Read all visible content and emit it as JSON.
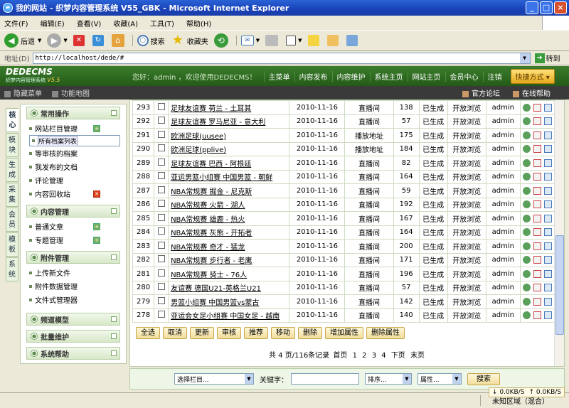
{
  "window": {
    "title": "我的网站 - 织梦内容管理系统 V55_GBK - Microsoft Internet Explorer"
  },
  "menu": [
    "文件(F)",
    "编辑(E)",
    "查看(V)",
    "收藏(A)",
    "工具(T)",
    "帮助(H)"
  ],
  "toolbar": {
    "back": "后退",
    "search": "搜索",
    "favorites": "收藏夹"
  },
  "address": {
    "label": "地址(D)",
    "url": "http://localhost/dede/#",
    "go": "转到"
  },
  "dede": {
    "logo": "DEDECMS",
    "logo_sub": "织梦内容管理系统",
    "version": "V5.5",
    "welcome": "您好：admin ，欢迎使用DEDECMS！",
    "nav": [
      "主菜单",
      "内容发布",
      "内容维护",
      "系统主页",
      "网站主页",
      "会员中心",
      "注销"
    ],
    "shortcut": "快捷方式"
  },
  "subbar": {
    "hide": "隐藏菜单",
    "map": "功能地图",
    "forum": "官方论坛",
    "help": "在线帮助"
  },
  "vtabs": [
    "核心",
    "模块",
    "生成",
    "采集",
    "会员",
    "模板",
    "系统"
  ],
  "sidebar": {
    "g1": "常用操作",
    "g1_items": [
      "网站栏目管理",
      "所有档案列表",
      "等审核的档案",
      "我发布的文档",
      "评论管理",
      "内容回收站"
    ],
    "g2": "内容管理",
    "g2_items": [
      "普通文章",
      "专题管理"
    ],
    "g3": "附件管理",
    "g3_items": [
      "上传新文件",
      "附件数据管理",
      "文件式管理器"
    ],
    "g4": "频道模型",
    "g5": "批量维护",
    "g6": "系统帮助"
  },
  "rows": [
    {
      "id": "293",
      "title": "足球友谊赛 荷兰 - 土耳其",
      "date": "2010-11-16",
      "type": "直播间",
      "clicks": "138",
      "status": "已生成",
      "perm": "开放浏览",
      "user": "admin"
    },
    {
      "id": "292",
      "title": "足球友谊赛 罗马尼亚 - 意大利",
      "date": "2010-11-16",
      "type": "直播间",
      "clicks": "57",
      "status": "已生成",
      "perm": "开放浏览",
      "user": "admin"
    },
    {
      "id": "291",
      "title": "欧洲足球(uusee)",
      "date": "2010-11-16",
      "type": "播放地址",
      "clicks": "175",
      "status": "已生成",
      "perm": "开放浏览",
      "user": "admin"
    },
    {
      "id": "290",
      "title": "欧洲足球(pplive)",
      "date": "2010-11-16",
      "type": "播放地址",
      "clicks": "184",
      "status": "已生成",
      "perm": "开放浏览",
      "user": "admin"
    },
    {
      "id": "289",
      "title": "足球友谊赛 巴西 - 阿根廷",
      "date": "2010-11-16",
      "type": "直播间",
      "clicks": "82",
      "status": "已生成",
      "perm": "开放浏览",
      "user": "admin"
    },
    {
      "id": "288",
      "title": "亚运男篮小组赛 中国男篮 - 朝鲜",
      "date": "2010-11-16",
      "type": "直播间",
      "clicks": "164",
      "status": "已生成",
      "perm": "开放浏览",
      "user": "admin"
    },
    {
      "id": "287",
      "title": "NBA常规赛 掘金 - 尼克斯",
      "date": "2010-11-16",
      "type": "直播间",
      "clicks": "59",
      "status": "已生成",
      "perm": "开放浏览",
      "user": "admin"
    },
    {
      "id": "286",
      "title": "NBA常规赛 火箭 - 湖人",
      "date": "2010-11-16",
      "type": "直播间",
      "clicks": "192",
      "status": "已生成",
      "perm": "开放浏览",
      "user": "admin"
    },
    {
      "id": "285",
      "title": "NBA常规赛 雄鹿 - 热火",
      "date": "2010-11-16",
      "type": "直播间",
      "clicks": "167",
      "status": "已生成",
      "perm": "开放浏览",
      "user": "admin"
    },
    {
      "id": "284",
      "title": "NBA常规赛 灰熊 - 开拓者",
      "date": "2010-11-16",
      "type": "直播间",
      "clicks": "164",
      "status": "已生成",
      "perm": "开放浏览",
      "user": "admin"
    },
    {
      "id": "283",
      "title": "NBA常规赛 奇才 - 猛龙",
      "date": "2010-11-16",
      "type": "直播间",
      "clicks": "200",
      "status": "已生成",
      "perm": "开放浏览",
      "user": "admin"
    },
    {
      "id": "282",
      "title": "NBA常规赛 步行者 - 老鹰",
      "date": "2010-11-16",
      "type": "直播间",
      "clicks": "171",
      "status": "已生成",
      "perm": "开放浏览",
      "user": "admin"
    },
    {
      "id": "281",
      "title": "NBA常规赛 骑士 - 76人",
      "date": "2010-11-16",
      "type": "直播间",
      "clicks": "196",
      "status": "已生成",
      "perm": "开放浏览",
      "user": "admin"
    },
    {
      "id": "280",
      "title": "友谊赛 德国U21-英格兰U21",
      "date": "2010-11-16",
      "type": "直播间",
      "clicks": "57",
      "status": "已生成",
      "perm": "开放浏览",
      "user": "admin"
    },
    {
      "id": "279",
      "title": "男篮小组赛 中国男篮vs蒙古",
      "date": "2010-11-16",
      "type": "直播间",
      "clicks": "142",
      "status": "已生成",
      "perm": "开放浏览",
      "user": "admin"
    },
    {
      "id": "278",
      "title": "亚运会女足小组赛 中国女足 - 越南",
      "date": "2010-11-16",
      "type": "直播间",
      "clicks": "140",
      "status": "已生成",
      "perm": "开放浏览",
      "user": "admin"
    }
  ],
  "actions": [
    "全选",
    "取消",
    "更新",
    "审核",
    "推荐",
    "移动",
    "删除",
    "增加属性",
    "删除属性"
  ],
  "pager": {
    "text": "共 4 页/116条记录",
    "first": "首页",
    "pages": [
      "1",
      "2",
      "3",
      "4"
    ],
    "next": "下页",
    "last": "末页"
  },
  "search": {
    "column": "选择栏目...",
    "keyword_label": "关键字：",
    "sort": "排序...",
    "attr": "属性...",
    "submit": "搜索"
  },
  "status": {
    "speed_down": "0.0KB/S",
    "speed_up": "0.0KB/S",
    "zone": "未知区域（混合）"
  }
}
